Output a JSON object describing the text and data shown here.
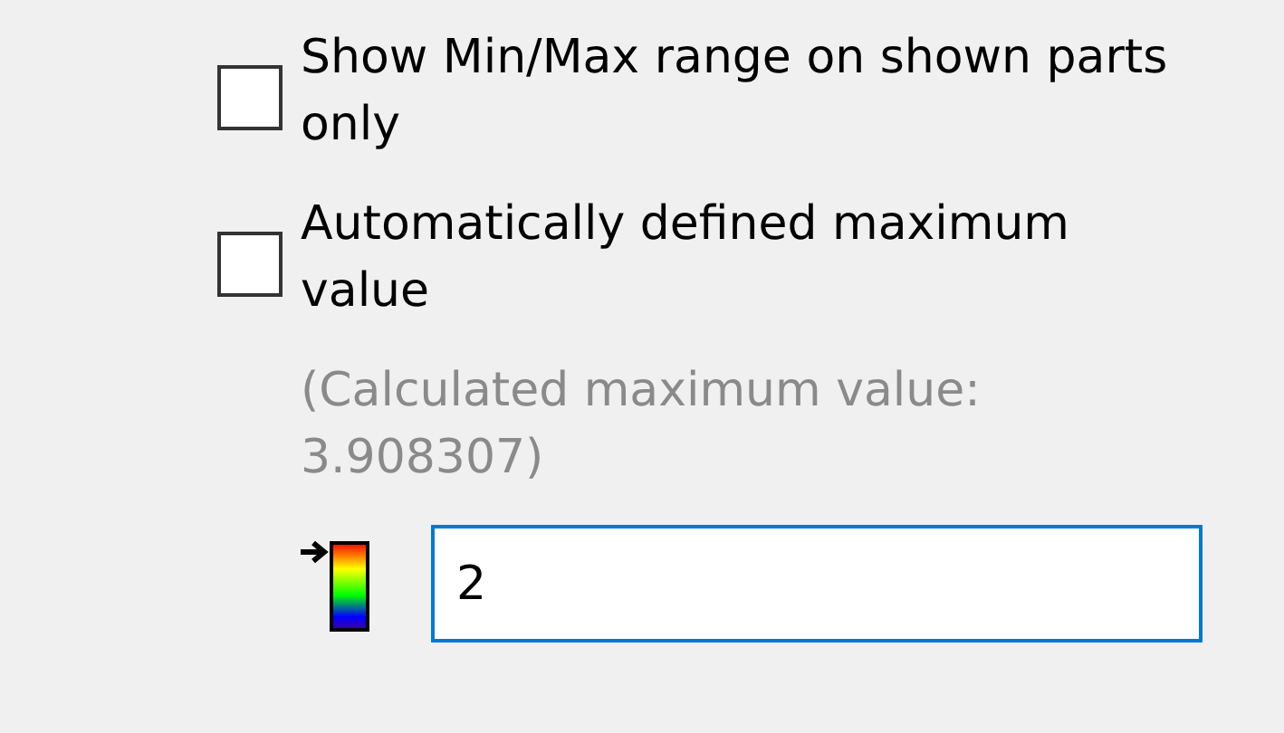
{
  "options": [
    {
      "label": "Show Min/Max range on shown parts only",
      "checked": false
    },
    {
      "label": "Automatically defined maximum value",
      "checked": false
    }
  ],
  "calculated_note": "(Calculated maximum value: 3.908307)",
  "maximum_field": {
    "value": "2"
  }
}
